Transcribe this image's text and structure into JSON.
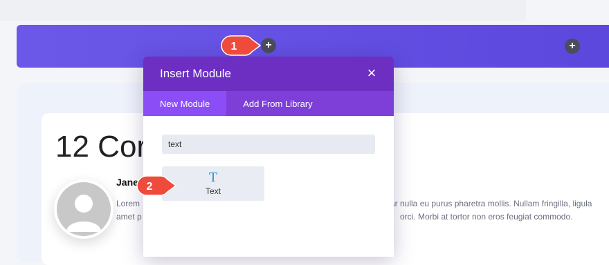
{
  "modal": {
    "title": "Insert Module",
    "close_icon": "×",
    "tabs": [
      {
        "label": "New Module",
        "active": true
      },
      {
        "label": "Add From Library",
        "active": false
      }
    ],
    "search": {
      "value": "text",
      "placeholder": ""
    },
    "modules": [
      {
        "label": "Text",
        "icon": "T"
      }
    ]
  },
  "callouts": [
    {
      "number": "1"
    },
    {
      "number": "2"
    }
  ],
  "add_buttons": {
    "symbol": "+"
  },
  "content": {
    "comments_heading": "12 Cor",
    "author_name": "Jane",
    "comment_lines": [
      "Lorem",
      "amet p",
      "ar nulla eu purus pharetra mollis. Nullam fringilla, ligula",
      "orci. Morbi at tortor non eros feugiat commodo."
    ]
  },
  "colors": {
    "row_purple": "#6c58e8",
    "modal_header": "#6c2fc2",
    "tab_bar": "#7e3fd8",
    "tab_active": "#8b4df5",
    "callout_red": "#ee4b3c",
    "module_icon": "#2b8fc9"
  }
}
